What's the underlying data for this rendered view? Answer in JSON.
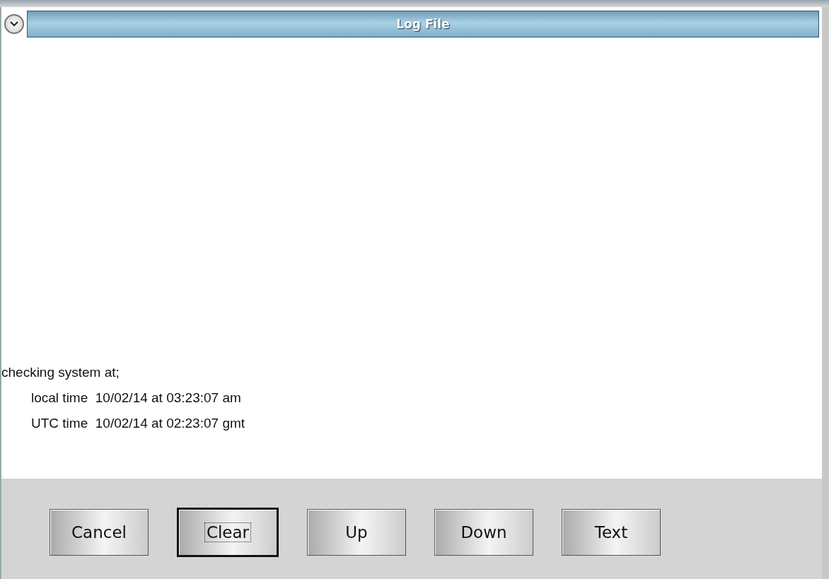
{
  "window": {
    "title": "Log File"
  },
  "log": [
    {
      "kind": "heading",
      "text": "checking system at;"
    },
    {
      "kind": "detail",
      "text": "local time  10/02/14 at 03:23:07 am"
    },
    {
      "kind": "detail",
      "text": "UTC time  10/02/14 at 02:23:07 gmt"
    }
  ],
  "buttons": [
    {
      "label": "Cancel",
      "focused": false
    },
    {
      "label": "Clear",
      "focused": true
    },
    {
      "label": "Up",
      "focused": false
    },
    {
      "label": "Down",
      "focused": false
    },
    {
      "label": "Text",
      "focused": false
    }
  ]
}
